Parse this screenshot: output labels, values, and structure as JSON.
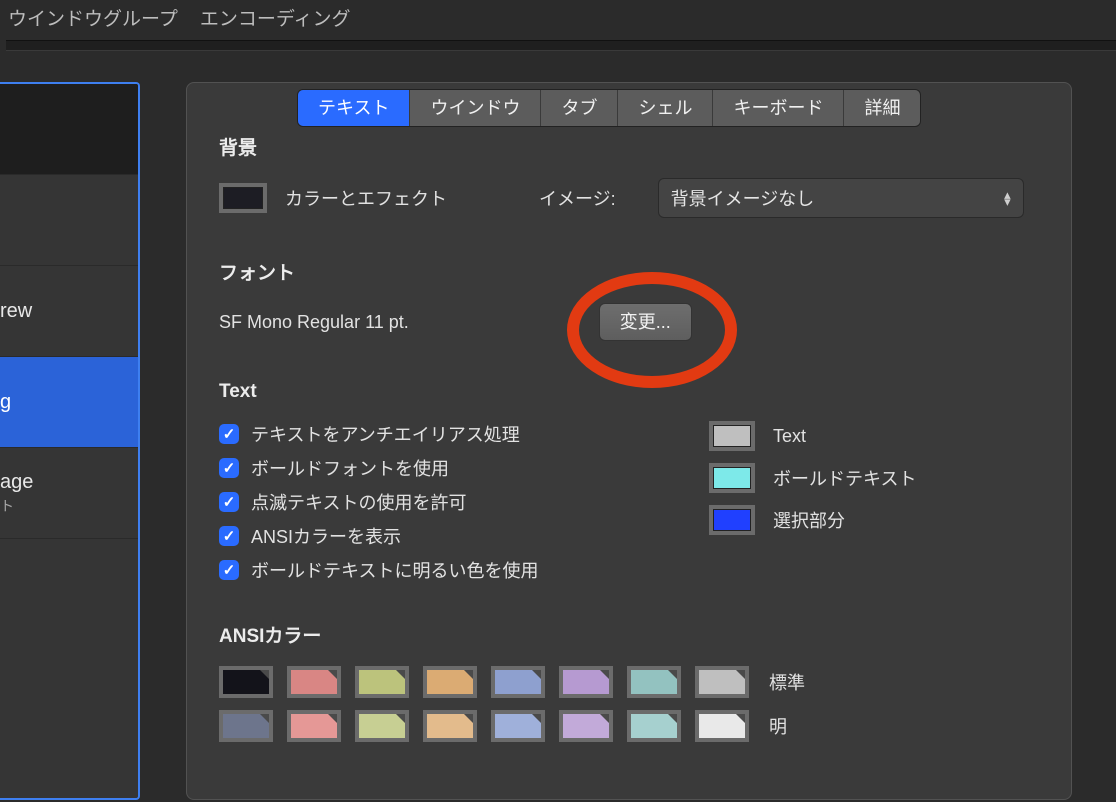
{
  "toolbar": {
    "tabs": [
      "ウインドウグループ",
      "エンコーディング"
    ]
  },
  "sidebar": {
    "items": [
      {
        "label": ""
      },
      {
        "label": ""
      },
      {
        "label": "rew"
      },
      {
        "label": "g",
        "selected": true
      },
      {
        "label": "age",
        "sub": "ト"
      }
    ]
  },
  "tabs": {
    "items": [
      "テキスト",
      "ウインドウ",
      "タブ",
      "シェル",
      "キーボード",
      "詳細"
    ],
    "selected_index": 0
  },
  "background": {
    "section_title": "背景",
    "color_effects_label": "カラーとエフェクト",
    "image_label": "イメージ:",
    "image_popup_value": "背景イメージなし",
    "well_color": "#1d1d24"
  },
  "font": {
    "section_title": "フォント",
    "current": "SF Mono Regular 11 pt.",
    "change_button": "変更..."
  },
  "text": {
    "section_title": "Text",
    "checkboxes": [
      "テキストをアンチエイリアス処理",
      "ボールドフォントを使用",
      "点滅テキストの使用を許可",
      "ANSIカラーを表示",
      "ボールドテキストに明るい色を使用"
    ],
    "swatches": [
      {
        "label": "Text",
        "color": "#bfbfbf"
      },
      {
        "label": "ボールドテキスト",
        "color": "#7de9e9"
      },
      {
        "label": "選択部分",
        "color": "#2040ff"
      }
    ]
  },
  "ansi": {
    "section_title": "ANSIカラー",
    "normal_label": "標準",
    "bright_label": "明",
    "normal": [
      "#13131a",
      "#d98684",
      "#bcc37c",
      "#dbab73",
      "#8ea0cf",
      "#b69ad1",
      "#93c2c0",
      "#bfbfbf"
    ],
    "bright": [
      "#6d758c",
      "#e59896",
      "#c7cf93",
      "#e3bb8c",
      "#9fb0da",
      "#c2aad9",
      "#a6d0cf",
      "#e9e9e9"
    ]
  },
  "annotation": {
    "highlight": "change-button"
  }
}
